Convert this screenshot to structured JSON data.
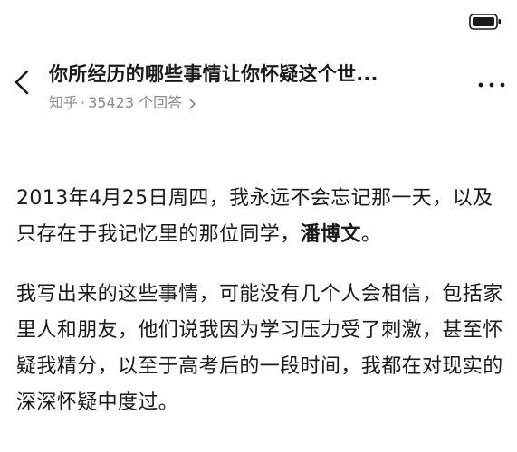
{
  "header": {
    "title": "你所经历的哪些事情让你怀疑这个世...",
    "source": "知乎",
    "separator": "·",
    "answers": "35423 个回答"
  },
  "icons": {
    "battery": "battery-icon",
    "back": "chevron-left-icon",
    "more": "more-horizontal-icon",
    "answers_chevron": "chevron-right-icon"
  },
  "content": {
    "p1_part1": "2013年4月25日周四，我永远不会忘记那一天，以及只存在于我记忆里的那位同学，",
    "p1_name": "潘博文",
    "p1_end": "。",
    "p2": "我写出来的这些事情，可能没有几个人会相信，包括家里人和朋友，他们说我因为学习压力受了刺激，甚至怀疑我精分，以至于高考后的一段时间，我都在对现实的深深怀疑中度过。"
  }
}
